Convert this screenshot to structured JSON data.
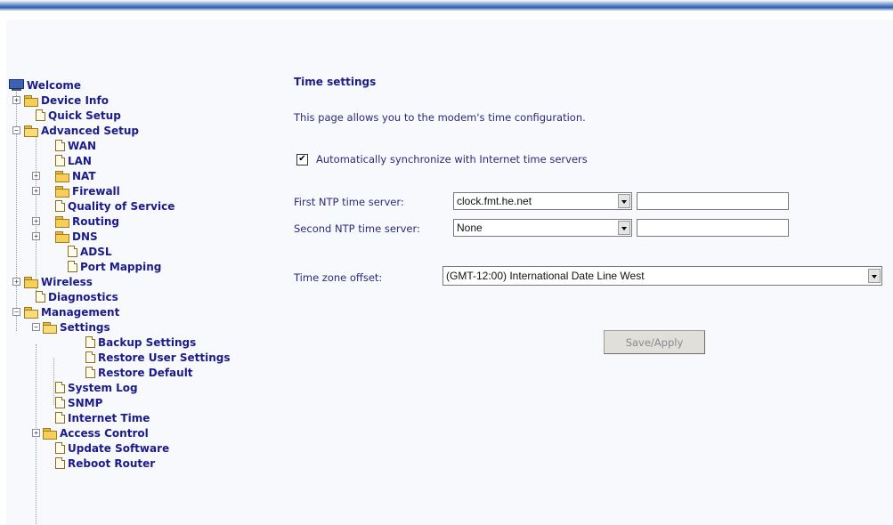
{
  "tree": {
    "welcome": "Welcome",
    "device_info": "Device Info",
    "quick_setup": "Quick Setup",
    "advanced_setup": "Advanced Setup",
    "wan": "WAN",
    "lan": "LAN",
    "nat": "NAT",
    "firewall": "Firewall",
    "qos": "Quality of Service",
    "routing": "Routing",
    "dns": "DNS",
    "adsl": "ADSL",
    "port_mapping": "Port Mapping",
    "wireless": "Wireless",
    "diagnostics": "Diagnostics",
    "management": "Management",
    "settings": "Settings",
    "backup_settings": "Backup Settings",
    "restore_user_settings": "Restore User Settings",
    "restore_default": "Restore Default",
    "system_log": "System Log",
    "snmp": "SNMP",
    "internet_time": "Internet Time",
    "access_control": "Access Control",
    "update_software": "Update Software",
    "reboot_router": "Reboot Router"
  },
  "content": {
    "title": "Time settings",
    "description": "This page allows you to the modem's time configuration.",
    "auto_sync_label": "Automatically synchronize with Internet time servers",
    "auto_sync_checked": "✔",
    "first_ntp_label": "First NTP time server:",
    "first_ntp_value": "clock.fmt.he.net",
    "second_ntp_label": "Second NTP time server:",
    "second_ntp_value": "None",
    "timezone_label": "Time zone offset:",
    "timezone_value": "(GMT-12:00) International Date Line West",
    "save_button": "Save/Apply"
  }
}
